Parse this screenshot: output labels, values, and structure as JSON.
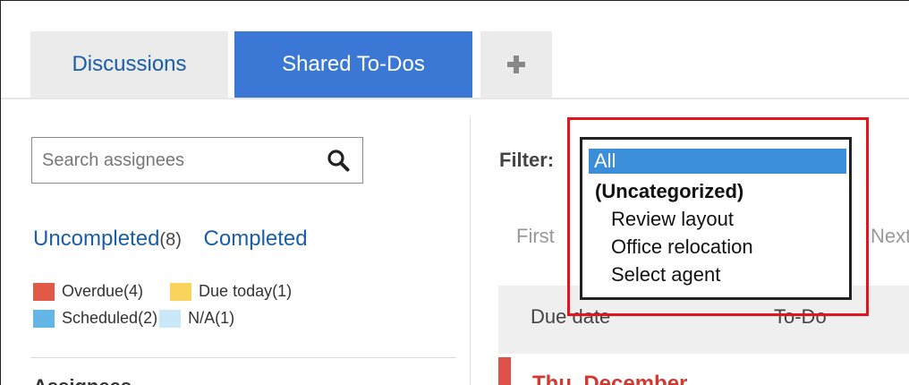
{
  "tabs": [
    {
      "label": "Discussions"
    },
    {
      "label": "Shared To-Dos"
    }
  ],
  "icons": {
    "add_tab": "plus-icon",
    "search": "search-icon"
  },
  "search": {
    "placeholder": "Search assignees"
  },
  "status_links": {
    "uncompleted_label": "Uncompleted",
    "uncompleted_count": "(8)",
    "completed_label": "Completed"
  },
  "legend": [
    {
      "label": "Overdue(4)",
      "color": "#e05a45"
    },
    {
      "label": "Due today(1)",
      "color": "#f9d35c"
    },
    {
      "label": "Scheduled(2)",
      "color": "#63b6e6"
    },
    {
      "label": "N/A(1)",
      "color": "#c9e8f8"
    }
  ],
  "assignees_heading": "Assignees",
  "filter": {
    "label": "Filter:",
    "options": [
      "All",
      "(Uncategorized)",
      "Review layout",
      "Office relocation",
      "Select agent"
    ],
    "selected": "All"
  },
  "pagination": {
    "first": "First",
    "next": "Next"
  },
  "table": {
    "columns": [
      "Due date",
      "To-Do"
    ],
    "first_row_date": "Thu, December"
  },
  "colors": {
    "accent": "#3b78d6",
    "link": "#1b5ea8",
    "highlight": "#e3141b",
    "overdue": "#e05a45"
  }
}
